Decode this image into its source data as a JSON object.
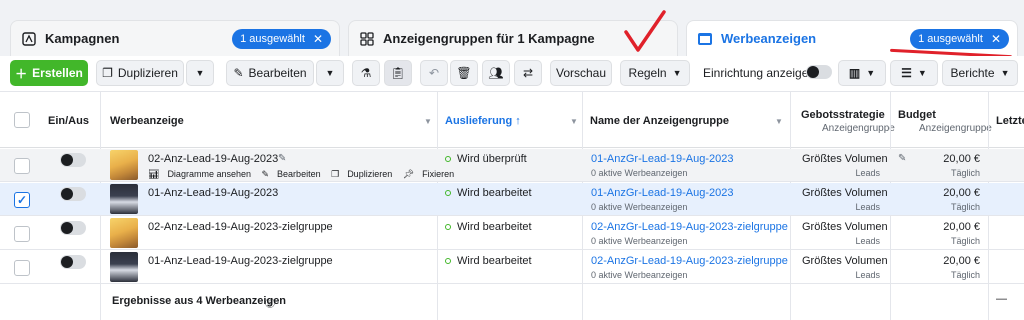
{
  "tabs": [
    {
      "label": "Kampagnen",
      "icon": "campaign-icon",
      "badge": "1 ausgewählt"
    },
    {
      "label": "Anzeigengruppen für 1 Kampagne",
      "icon": "adset-grid-icon"
    },
    {
      "label": "Werbeanzeigen",
      "icon": "ad-window-icon",
      "badge": "1 ausgewählt"
    }
  ],
  "toolbar": {
    "create": "Erstellen",
    "duplicate": "Duplizieren",
    "edit": "Bearbeiten",
    "preview": "Vorschau",
    "rules": "Regeln",
    "setup_toggle_label": "Einrichtung anzeigen",
    "reports": "Berichte"
  },
  "columns": {
    "onoff": "Ein/Aus",
    "ad": "Werbeanzeige",
    "delivery": "Auslieferung ↑",
    "adset_name": "Name der Anzeigengruppe",
    "bid_strategy": "Gebotsstrategie",
    "bid_strategy_sub": "Anzeigengruppe",
    "budget": "Budget",
    "budget_sub": "Anzeigengruppe",
    "last": "Letzte"
  },
  "rows": [
    {
      "name": "02-Anz-Lead-19-Aug-2023",
      "actions": [
        "Diagramme ansehen",
        "Bearbeiten",
        "Duplizieren",
        "Fixieren"
      ],
      "delivery": "Wird überprüft",
      "adset": "01-AnzGr-Lead-19-Aug-2023",
      "adset_sub": "0 aktive Werbeanzeigen",
      "bid": "Größtes Volumen",
      "bid_sub": "Leads",
      "budget": "20,00 €",
      "budget_sub": "Täglich",
      "selected": false
    },
    {
      "name": "01-Anz-Lead-19-Aug-2023",
      "delivery": "Wird bearbeitet",
      "adset": "01-AnzGr-Lead-19-Aug-2023",
      "adset_sub": "0 aktive Werbeanzeigen",
      "bid": "Größtes Volumen",
      "bid_sub": "Leads",
      "budget": "20,00 €",
      "budget_sub": "Täglich",
      "selected": true
    },
    {
      "name": "02-Anz-Lead-19-Aug-2023-zielgruppe",
      "delivery": "Wird bearbeitet",
      "adset": "02-AnzGr-Lead-19-Aug-2023-zielgruppe",
      "adset_sub": "0 aktive Werbeanzeigen",
      "bid": "Größtes Volumen",
      "bid_sub": "Leads",
      "budget": "20,00 €",
      "budget_sub": "Täglich",
      "selected": false
    },
    {
      "name": "01-Anz-Lead-19-Aug-2023-zielgruppe",
      "delivery": "Wird bearbeitet",
      "adset": "02-AnzGr-Lead-19-Aug-2023-zielgruppe",
      "adset_sub": "0 aktive Werbeanzeigen",
      "bid": "Größtes Volumen",
      "bid_sub": "Leads",
      "budget": "20,00 €",
      "budget_sub": "Täglich",
      "selected": false
    }
  ],
  "summary": "Ergebnisse aus 4 Werbeanzeigen",
  "summary_last": "—",
  "colors": {
    "accent": "#1b74e4",
    "create_green": "#42b72a",
    "annotation_red": "#e0212a"
  }
}
